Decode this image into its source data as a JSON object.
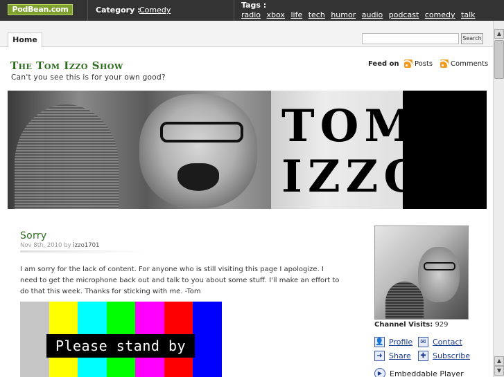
{
  "topbar": {
    "logo": "PodBean.com",
    "category_label": "Category :",
    "category_value": "Comedy",
    "tags_label": "Tags :",
    "tags": [
      "radio",
      "xbox",
      "life",
      "tech",
      "humor",
      "audio",
      "podcast",
      "comedy",
      "talk"
    ]
  },
  "nav": {
    "home_tab": "Home",
    "search_placeholder": "",
    "search_button": "Search"
  },
  "header": {
    "title": "The Tom Izzo Show",
    "tagline": "Can't you see this is for your own good?",
    "feed_label": "Feed on",
    "feed_posts": "Posts",
    "feed_comments": "Comments"
  },
  "banner": {
    "line1": "TOM",
    "line2": "IZZO"
  },
  "post": {
    "title": "Sorry",
    "date": "Nov 8th, 2010",
    "by": "by",
    "author": "izzo1701",
    "body": "I am sorry for the lack of content. For anyone who is still visiting this page I apologize. I need to get the microphone back out and talk to you about some stuff. I'll make an effort to do that this week. Thanks for sticking with me. -Tom",
    "image_text": "Please stand by",
    "bar_colors": [
      "#c6c6c6",
      "#ffff00",
      "#00ffff",
      "#00ff00",
      "#ff00ff",
      "#ff0000",
      "#0000ff"
    ]
  },
  "sidebar": {
    "visits_label": "Channel Visits:",
    "visits_count": "929",
    "profile": "Profile",
    "contact": "Contact",
    "share": "Share",
    "subscribe": "Subscribe",
    "embeddable_player": "Embeddable Player"
  },
  "colors": {
    "accent_green": "#2d6b1e",
    "topbar": "#333333",
    "link_blue": "#1a3a8a"
  }
}
